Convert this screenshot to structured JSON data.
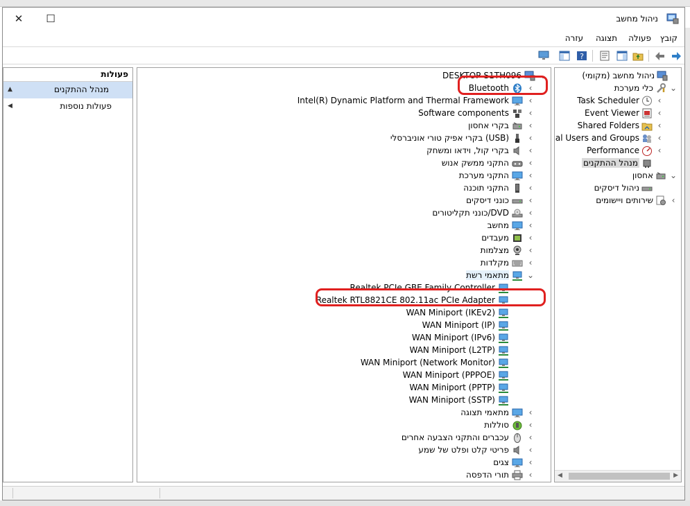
{
  "window": {
    "title": "ניהול מחשב",
    "close_glyph": "✕",
    "max_glyph": "☐"
  },
  "menu": [
    "קובץ",
    "פעולה",
    "תצוגה",
    "עזרה"
  ],
  "actions": {
    "header": "פעולות",
    "items": [
      {
        "label": "מנהל ההתקנים",
        "selected": true
      },
      {
        "label": "פעולות נוספות",
        "selected": false
      }
    ]
  },
  "devices": {
    "root": "DESKTOP-S1TH096",
    "categories": [
      {
        "label": "Bluetooth",
        "icon": "bluetooth-icon",
        "expanded": false
      },
      {
        "label": "Intel(R) Dynamic Platform and Thermal Framework",
        "icon": "monitor-icon",
        "expanded": false
      },
      {
        "label": "Software components",
        "icon": "component-icon",
        "expanded": false
      },
      {
        "label": "בקרי אחסון",
        "icon": "storage-icon",
        "expanded": false
      },
      {
        "label": "בקרי אפיק טורי אוניברסלי (USB)",
        "icon": "usb-icon",
        "expanded": false
      },
      {
        "label": "בקרי קול, וידאו ומשחק",
        "icon": "speaker-icon",
        "expanded": false
      },
      {
        "label": "התקני ממשק אנוש",
        "icon": "hid-icon",
        "expanded": false
      },
      {
        "label": "התקני מערכת",
        "icon": "monitor-icon",
        "expanded": false
      },
      {
        "label": "התקני תוכנה",
        "icon": "device-icon",
        "expanded": false
      },
      {
        "label": "כונני דיסקים",
        "icon": "disk-icon",
        "expanded": false
      },
      {
        "label": "כונני תקליטורים/DVD",
        "icon": "dvd-icon",
        "expanded": false
      },
      {
        "label": "מחשב",
        "icon": "monitor-icon",
        "expanded": false
      },
      {
        "label": "מעבדים",
        "icon": "cpu-icon",
        "expanded": false
      },
      {
        "label": "מצלמות",
        "icon": "camera-icon",
        "expanded": false
      },
      {
        "label": "מקלדות",
        "icon": "keyboard-icon",
        "expanded": false
      },
      {
        "label": "מתאמי רשת",
        "icon": "network-icon",
        "expanded": true
      }
    ],
    "network_children": [
      "Realtek PCIe GBE Family Controller",
      "Realtek RTL8821CE 802.11ac PCIe Adapter",
      "WAN Miniport (IKEv2)",
      "WAN Miniport (IP)",
      "WAN Miniport (IPv6)",
      "WAN Miniport (L2TP)",
      "WAN Miniport (Network Monitor)",
      "WAN Miniport (PPPOE)",
      "WAN Miniport (PPTP)",
      "WAN Miniport (SSTP)"
    ],
    "after_categories": [
      {
        "label": "מתאמי תצוגה",
        "icon": "display-icon"
      },
      {
        "label": "סוללות",
        "icon": "battery-icon"
      },
      {
        "label": "עכברים והתקני הצבעה אחרים",
        "icon": "mouse-icon"
      },
      {
        "label": "פריטי קלט ופלט של שמע",
        "icon": "speaker-icon"
      },
      {
        "label": "צגים",
        "icon": "monitor-icon"
      },
      {
        "label": "תורי הדפסה",
        "icon": "printer-icon"
      }
    ]
  },
  "tree": {
    "items": [
      {
        "label": "ניהול מחשב (מקומי)",
        "level": 0,
        "chev": "",
        "icon": "computer-management-icon",
        "selected": false
      },
      {
        "label": "כלי מערכת",
        "level": 1,
        "chev": "⌄",
        "icon": "tools-icon",
        "selected": false
      },
      {
        "label": "Task Scheduler",
        "level": 2,
        "chev": "‹",
        "icon": "clock-icon",
        "selected": false
      },
      {
        "label": "Event Viewer",
        "level": 2,
        "chev": "‹",
        "icon": "event-viewer-icon",
        "selected": false
      },
      {
        "label": "Shared Folders",
        "level": 2,
        "chev": "‹",
        "icon": "shared-folder-icon",
        "selected": false
      },
      {
        "label": "Local Users and Groups",
        "level": 2,
        "chev": "‹",
        "icon": "users-icon",
        "selected": false
      },
      {
        "label": "Performance",
        "level": 2,
        "chev": "‹",
        "icon": "performance-icon",
        "selected": false
      },
      {
        "label": "מנהל ההתקנים",
        "level": 2,
        "chev": "",
        "icon": "device-manager-icon",
        "selected": true
      },
      {
        "label": "אחסון",
        "level": 1,
        "chev": "⌄",
        "icon": "storage-icon",
        "selected": false
      },
      {
        "label": "ניהול דיסקים",
        "level": 2,
        "chev": "",
        "icon": "disk-icon",
        "selected": false
      },
      {
        "label": "שירותים ויישומים",
        "level": 1,
        "chev": "‹",
        "icon": "services-icon",
        "selected": false
      }
    ]
  },
  "colors": {
    "annotation": "#e0201f",
    "selection": "#cfe0f5",
    "icon_blue": "#2f7fc8"
  }
}
